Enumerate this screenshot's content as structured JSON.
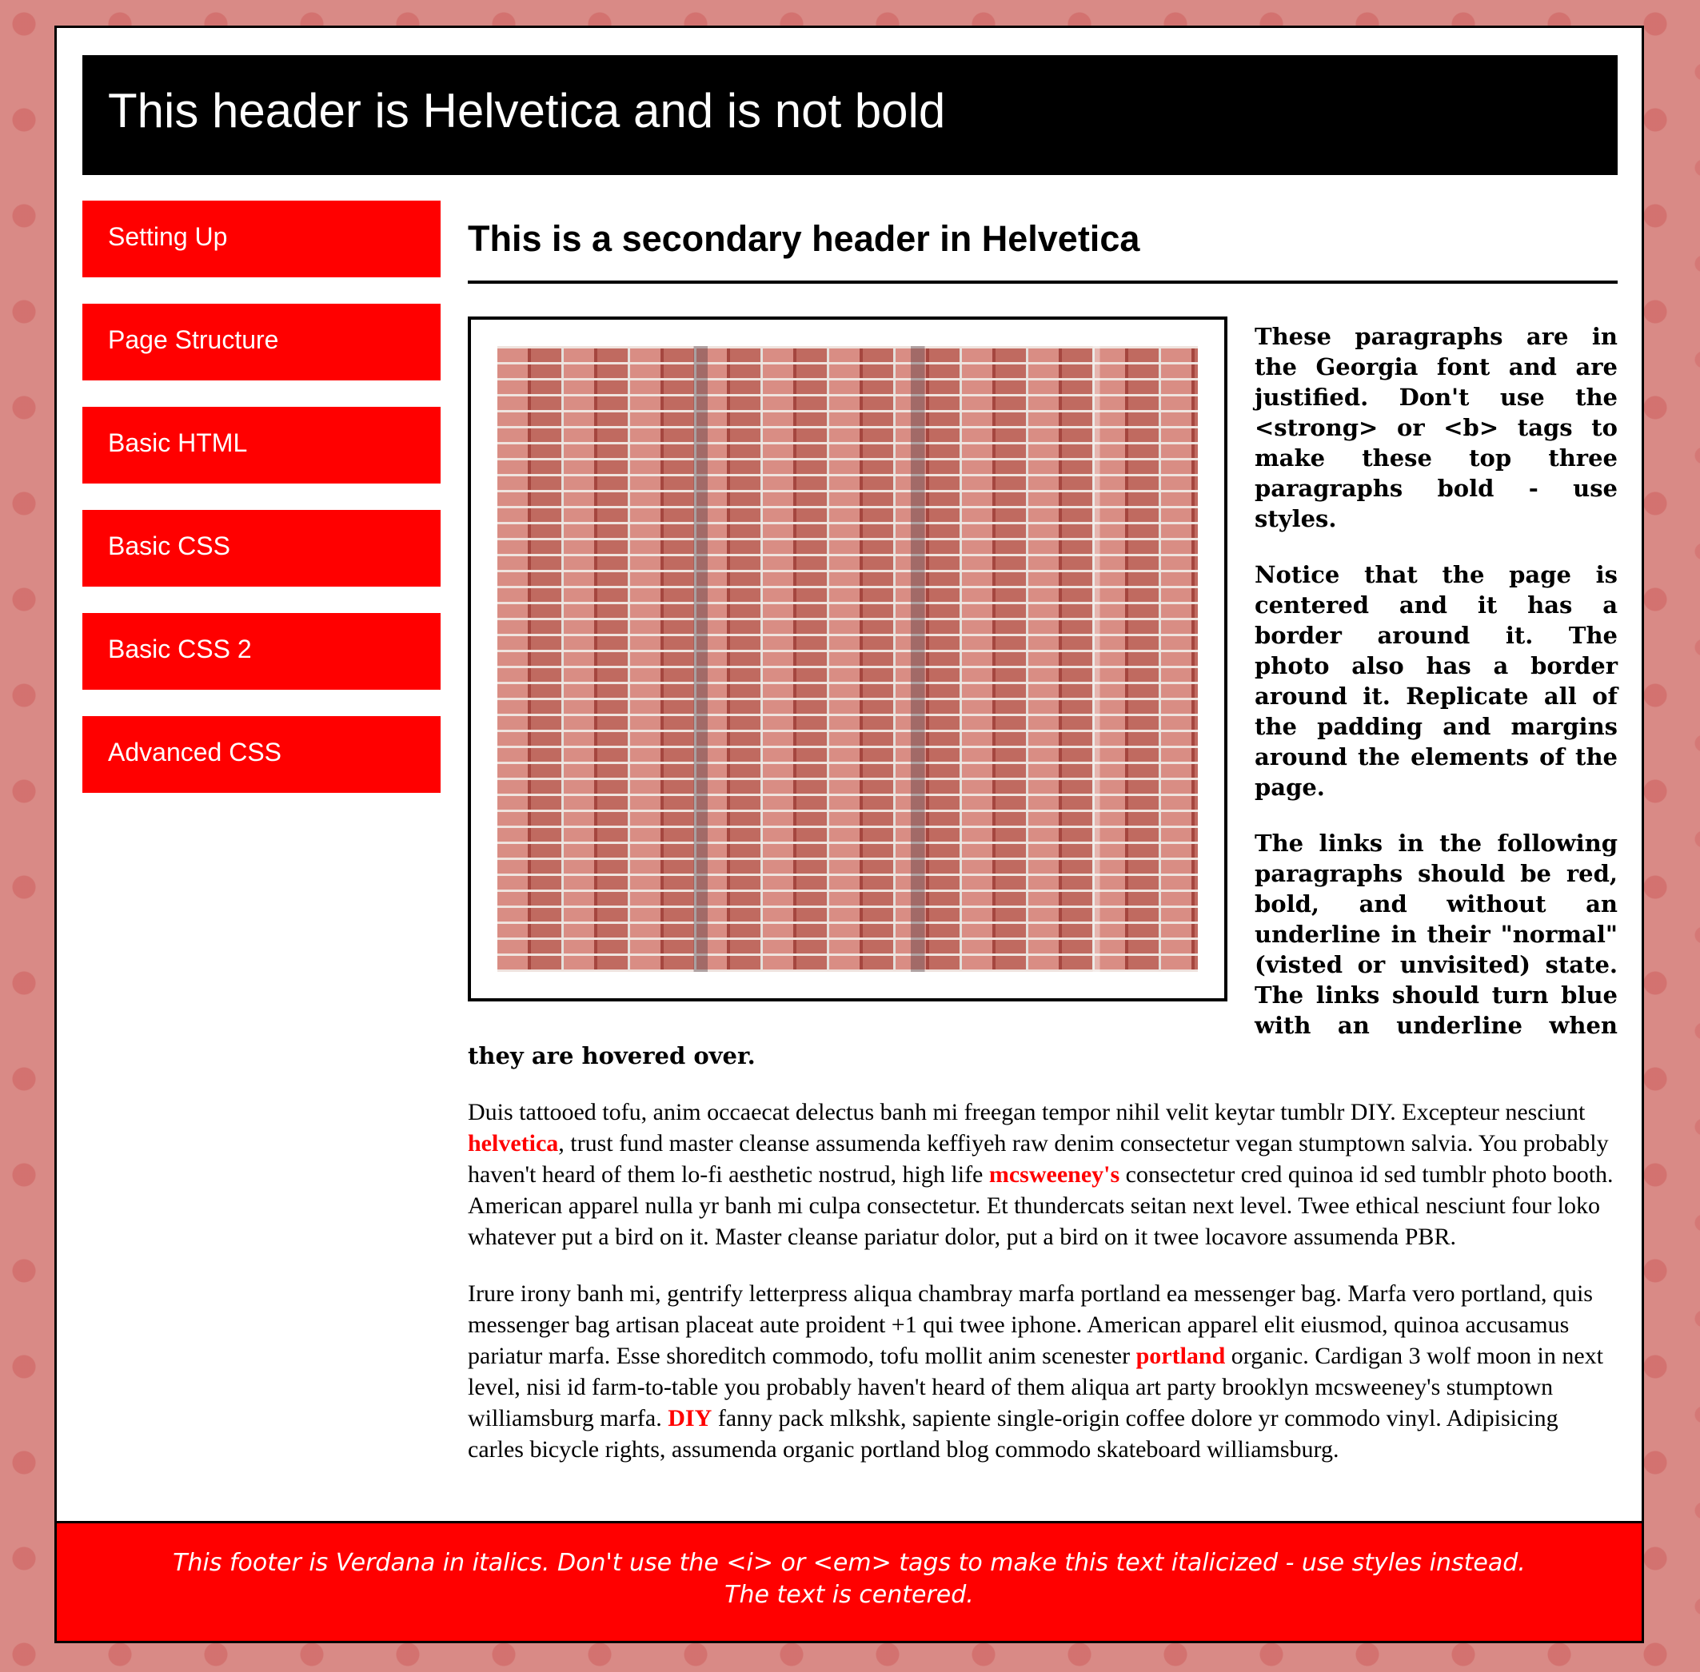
{
  "header": {
    "title": "This header is Helvetica and is not bold"
  },
  "nav": {
    "items": [
      {
        "label": "Setting Up"
      },
      {
        "label": "Page Structure"
      },
      {
        "label": "Basic HTML"
      },
      {
        "label": "Basic CSS"
      },
      {
        "label": "Basic CSS 2"
      },
      {
        "label": "Advanced CSS"
      }
    ]
  },
  "main": {
    "heading": "This is a secondary header in Helvetica",
    "p1": "These paragraphs are in the Georgia font and are justified. Don't use the <strong> or <b> tags to make these top three paragraphs bold - use styles.",
    "p2": "Notice that the page is centered and it has a border around it. The photo also has a border around it. Replicate all of the padding and margins around the elements of the page.",
    "p3": "The links in the following paragraphs should be red, bold, and without an underline in their \"normal\" (visted or unvisited) state. The links should turn blue with an underline when they are hovered over.",
    "p4": {
      "t1": "Duis tattooed tofu, anim occaecat delectus banh mi freegan tempor nihil velit keytar tumblr DIY. Excepteur nesciunt ",
      "link1": "helvetica",
      "t2": ", trust fund master cleanse assumenda keffiyeh raw denim consectetur vegan stumptown salvia. You probably haven't heard of them lo-fi aesthetic nostrud, high life ",
      "link2": "mcsweeney's",
      "t3": " consectetur cred quinoa id sed tumblr photo booth. American apparel nulla yr banh mi culpa consectetur. Et thundercats seitan next level. Twee ethical nesciunt four loko whatever put a bird on it. Master cleanse pariatur dolor, put a bird on it twee locavore assumenda PBR."
    },
    "p5": {
      "t1": "Irure irony banh mi, gentrify letterpress aliqua chambray marfa portland ea messenger bag. Marfa vero portland, quis messenger bag artisan placeat aute proident +1 qui twee iphone. American apparel elit eiusmod, quinoa accusamus pariatur marfa. Esse shoreditch commodo, tofu mollit anim scenester ",
      "link1": "portland",
      "t2": " organic. Cardigan 3 wolf moon in next level, nisi id farm-to-table you probably haven't heard of them aliqua art party brooklyn mcsweeney's stumptown williamsburg marfa. ",
      "link2": "DIY",
      "t3": " fanny pack mlkshk, sapiente single-origin coffee dolore yr commodo vinyl. Adipisicing carles bicycle rights, assumenda organic portland blog commodo skateboard williamsburg."
    }
  },
  "footer": {
    "line1": "This footer is Verdana in italics. Don't use the <i> or <em> tags to make this text italicized - use styles instead.",
    "line2": "The text is centered."
  },
  "colors": {
    "accent": "#ff0000",
    "header_bg": "#000000",
    "page_bg": "#ffffff"
  }
}
